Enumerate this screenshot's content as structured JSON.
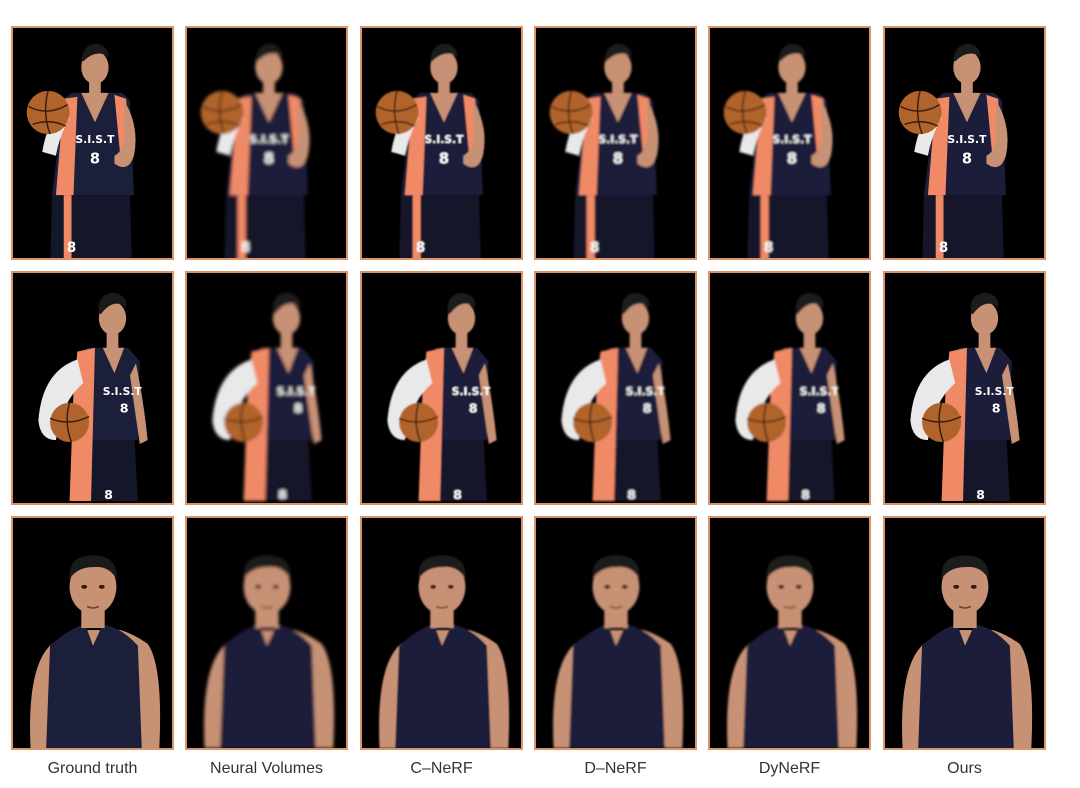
{
  "figure": {
    "rows": [
      {
        "view": "full-body-dribbling"
      },
      {
        "view": "side-holding-ball"
      },
      {
        "view": "close-up-upper-body"
      }
    ],
    "columns": [
      {
        "label": "Ground truth",
        "blur": 0
      },
      {
        "label": "Neural Volumes",
        "blur": 1.6
      },
      {
        "label": "C–NeRF",
        "blur": 0.9
      },
      {
        "label": "D–NeRF",
        "blur": 1.2
      },
      {
        "label": "DyNeRF",
        "blur": 1.0
      },
      {
        "label": "Ours",
        "blur": 0.3
      }
    ],
    "jersey_text": "S.I.S.T",
    "jersey_number": "8",
    "colors": {
      "frame": "#d9946a",
      "background": "#000000",
      "jersey": "#1c1f3a",
      "side_panel": "#f08a66",
      "skin": "#c79174",
      "ball": "#b0642c",
      "sleeve": "#e9e9e9",
      "hair": "#1a1a1a"
    }
  }
}
